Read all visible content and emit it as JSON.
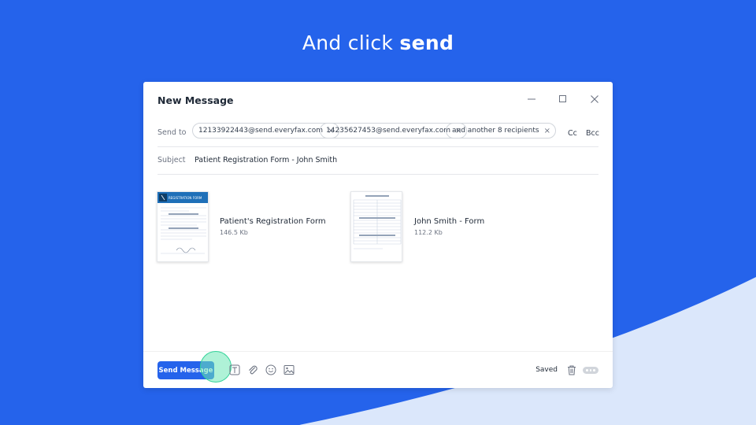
{
  "headline": {
    "normal": "And click",
    "bold": "send"
  },
  "dialog": {
    "title": "New Message",
    "send_to_label": "Send to",
    "recipients": [
      "12133922443@send.everyfax.com",
      "14235627453@send.everyfax.com",
      "and another 8 recipients"
    ],
    "chip_remove_glyph": "×",
    "cc_label": "Cc",
    "bcc_label": "Bcc",
    "subject_label": "Subject",
    "subject_value": "Patient Registration Form - John Smith",
    "attachments": [
      {
        "name": "Patient's Registration Form",
        "size": "146.5 Kb",
        "thumb_title": "REGISTRATION FORM"
      },
      {
        "name": "John Smith - Form",
        "size": "112.2 Kb"
      }
    ],
    "footer": {
      "send_label": "Send Message",
      "saved_label": "Saved",
      "icons": [
        "text-format-icon",
        "paperclip-icon",
        "emoji-icon",
        "image-icon",
        "trash-icon",
        "more-icon"
      ]
    }
  },
  "colors": {
    "background": "#2563eb",
    "accent": "#2563eb",
    "curve": "#dbe7fb",
    "cursor": "#6ee7b7"
  }
}
